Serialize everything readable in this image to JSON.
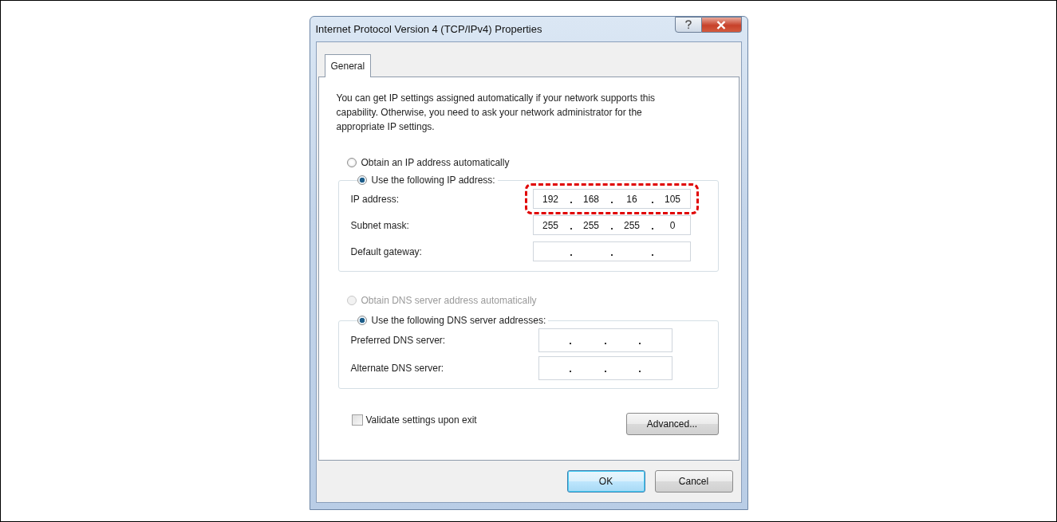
{
  "window": {
    "title": "Internet Protocol Version 4 (TCP/IPv4) Properties"
  },
  "tabs": [
    {
      "label": "General",
      "selected": true
    }
  ],
  "intro": "You can get IP settings assigned automatically if your network supports this capability. Otherwise, you need to ask your network administrator for the appropriate IP settings.",
  "ip_settings": {
    "options": [
      {
        "label": "Obtain an IP address automatically",
        "selected": false,
        "disabled": false
      },
      {
        "label": "Use the following IP address:",
        "selected": true,
        "disabled": false
      }
    ],
    "fields": [
      {
        "label": "IP address:",
        "octets": [
          "192",
          "168",
          "16",
          "105"
        ],
        "highlighted": true
      },
      {
        "label": "Subnet mask:",
        "octets": [
          "255",
          "255",
          "255",
          "0"
        ],
        "highlighted": false
      },
      {
        "label": "Default gateway:",
        "highlighted": false
      }
    ]
  },
  "dns_settings": {
    "options": [
      {
        "label": "Obtain DNS server address automatically",
        "selected": false,
        "disabled": true
      },
      {
        "label": "Use the following DNS server addresses:",
        "selected": true,
        "disabled": false
      }
    ],
    "fields": [
      {
        "label": "Preferred DNS server:",
        "highlighted": false
      },
      {
        "label": "Alternate DNS server:",
        "highlighted": false
      }
    ]
  },
  "validate": {
    "label": "Validate settings upon exit",
    "checked": false
  },
  "advanced_button": "Advanced...",
  "buttons": [
    {
      "label": "OK",
      "default": true
    },
    {
      "label": "Cancel",
      "default": false
    }
  ]
}
